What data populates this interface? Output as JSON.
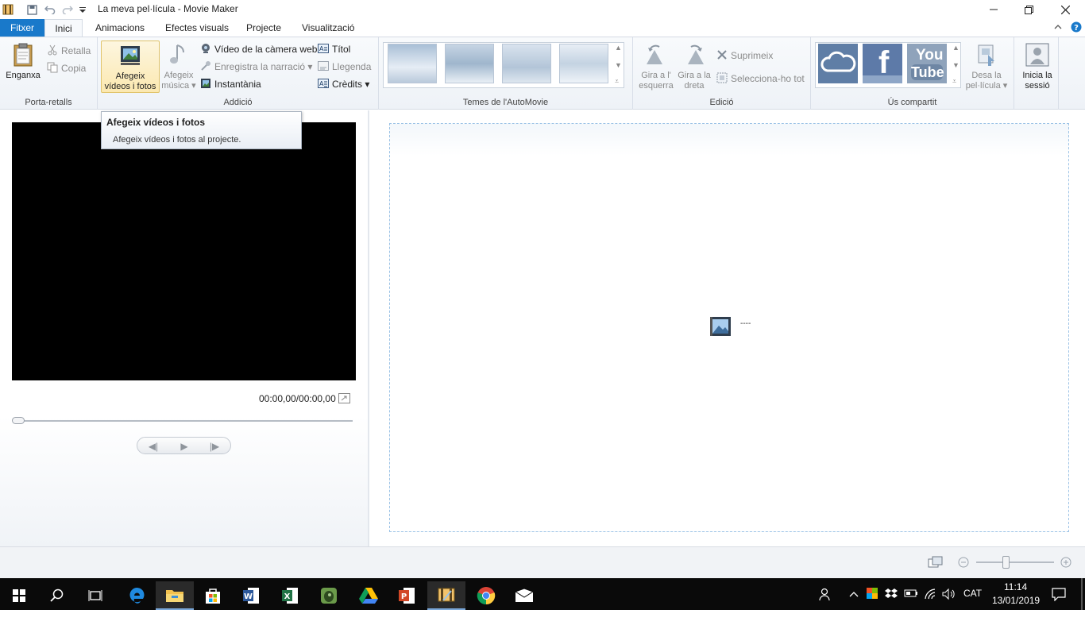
{
  "window": {
    "title": "La meva pel·lícula - Movie Maker",
    "controls": {
      "minimize": "—",
      "restore": "❐",
      "close": "✕"
    }
  },
  "tabs": [
    {
      "label": "Fitxer"
    },
    {
      "label": "Inici"
    },
    {
      "label": "Animacions"
    },
    {
      "label": "Efectes visuals"
    },
    {
      "label": "Projecte"
    },
    {
      "label": "Visualització"
    }
  ],
  "ribbon": {
    "clipboard": {
      "label": "Porta-retalls",
      "paste": "Enganxa",
      "cut": "Retalla",
      "copy": "Copia"
    },
    "add": {
      "label": "Addició",
      "add_videos_line1": "Afegeix",
      "add_videos_line2": "vídeos i fotos",
      "add_music_line1": "Afegeix",
      "add_music_line2": "música",
      "webcam": "Vídeo de la càmera web",
      "narration": "Enregistra la narració",
      "snapshot": "Instantània",
      "title": "Títol",
      "caption": "Llegenda",
      "credits": "Crèdits"
    },
    "themes": {
      "label": "Temes de l'AutoMovie"
    },
    "editing": {
      "label": "Edició",
      "rotate_left_line1": "Gira a l'",
      "rotate_left_line2": "esquerra",
      "rotate_right_line1": "Gira a la",
      "rotate_right_line2": "dreta",
      "remove": "Suprimeix",
      "select_all": "Selecciona-ho tot"
    },
    "share": {
      "label": "Ús compartit",
      "save_line1": "Desa la",
      "save_line2": "pel·lícula",
      "youtube_line1": "You",
      "youtube_line2": "Tube",
      "facebook": "f"
    },
    "signin": {
      "line1": "Inicia la",
      "line2": "sessió"
    }
  },
  "tooltip": {
    "title": "Afegeix vídeos i fotos",
    "body": "Afegeix vídeos i fotos al projecte."
  },
  "preview": {
    "time": "00:00,00/00:00,00"
  },
  "storyboard": {
    "placeholder_dash": "----"
  },
  "taskbar": {
    "language": "CAT",
    "time": "11:14",
    "date": "13/01/2019"
  },
  "colors": {
    "accent": "#1979ca",
    "taskbar": "#0a0a0a",
    "storyboard_border": "#9cc3e6"
  }
}
